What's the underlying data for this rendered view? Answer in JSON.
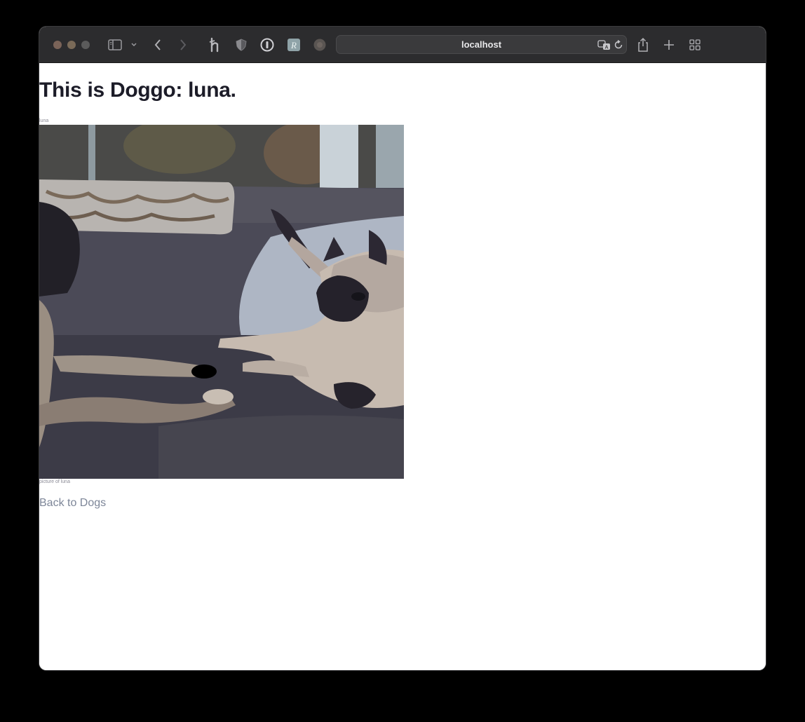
{
  "browser": {
    "address": "localhost"
  },
  "page": {
    "title": "This is Doggo: luna.",
    "image_caption_top": "luna",
    "image_caption_bottom": "picture of luna",
    "image_alt": "luna",
    "back_link": "Back to Dogs"
  },
  "colors": {
    "toolbar_bg": "#2c2c2e",
    "page_bg": "#ffffff",
    "title": "#1c1c28",
    "link": "#7d8698"
  },
  "icons": [
    "sidebar-icon",
    "chevron-down-icon",
    "back-arrow-icon",
    "forward-arrow-icon",
    "honey-extension-icon",
    "privacy-shield-icon",
    "password-manager-icon",
    "extension-r-icon",
    "extension-circle-icon",
    "translate-icon",
    "reload-icon",
    "share-icon",
    "new-tab-icon",
    "tab-overview-icon"
  ]
}
